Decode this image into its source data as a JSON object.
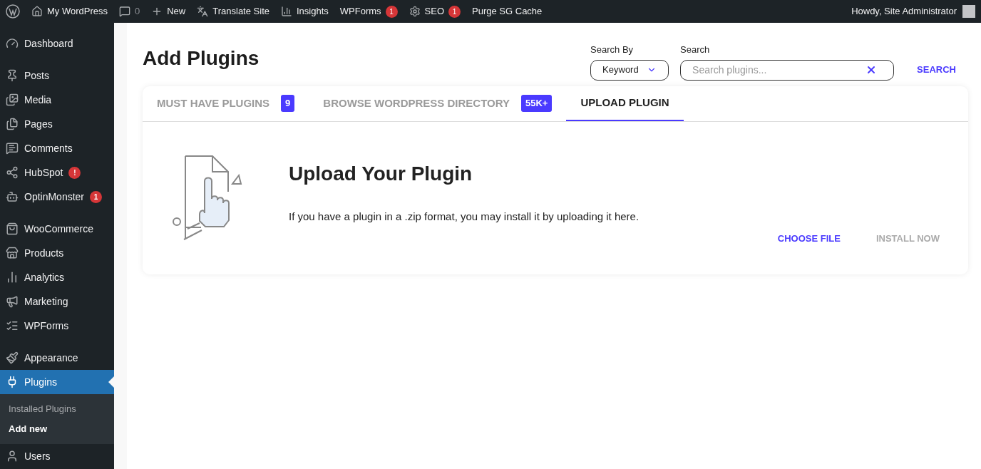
{
  "admin_bar": {
    "items": [
      {
        "label": "My WordPress"
      },
      {
        "label": "0"
      },
      {
        "label": "New"
      },
      {
        "label": "Translate Site"
      },
      {
        "label": "Insights"
      },
      {
        "label": "WPForms",
        "badge": "1"
      },
      {
        "label": "SEO",
        "badge": "1"
      },
      {
        "label": "Purge SG Cache"
      }
    ],
    "greeting": "Howdy, Site Administrator"
  },
  "sidebar": {
    "groups": [
      {
        "items": [
          {
            "label": "Dashboard",
            "selected": false
          }
        ]
      },
      {
        "items": [
          {
            "label": "Posts",
            "selected": false
          },
          {
            "label": "Media",
            "selected": false
          },
          {
            "label": "Pages",
            "selected": false
          },
          {
            "label": "Comments",
            "selected": false
          },
          {
            "label": "HubSpot",
            "selected": false,
            "badge": "!"
          },
          {
            "label": "OptinMonster",
            "selected": false,
            "badge": "1"
          }
        ]
      },
      {
        "items": [
          {
            "label": "WooCommerce",
            "selected": false
          },
          {
            "label": "Products",
            "selected": false
          },
          {
            "label": "Analytics",
            "selected": false
          },
          {
            "label": "Marketing",
            "selected": false
          },
          {
            "label": "WPForms",
            "selected": false
          }
        ]
      },
      {
        "items": [
          {
            "label": "Appearance",
            "selected": false
          },
          {
            "label": "Plugins",
            "selected": true,
            "children": [
              {
                "label": "Installed Plugins",
                "selected": false
              },
              {
                "label": "Add new",
                "selected": true
              }
            ]
          },
          {
            "label": "Users",
            "selected": false
          }
        ]
      }
    ]
  },
  "page": {
    "title": "Add Plugins",
    "search_by": {
      "label": "Search By",
      "value": "Keyword"
    },
    "search": {
      "label": "Search",
      "placeholder": "Search plugins..."
    },
    "search_button": "SEARCH",
    "tabs": [
      {
        "label": "MUST HAVE PLUGINS",
        "badge": "9",
        "selected": false
      },
      {
        "label": "BROWSE WORDPRESS DIRECTORY",
        "badge": "55K+",
        "selected": false
      },
      {
        "label": "UPLOAD PLUGIN",
        "selected": true
      }
    ],
    "upload": {
      "heading": "Upload Your Plugin",
      "text": "If you have a plugin in a .zip format, you may install it by uploading it here.",
      "buttons": [
        {
          "label": "CHOOSE FILE",
          "disabled": false
        },
        {
          "label": "INSTALL NOW",
          "disabled": true
        }
      ]
    }
  }
}
